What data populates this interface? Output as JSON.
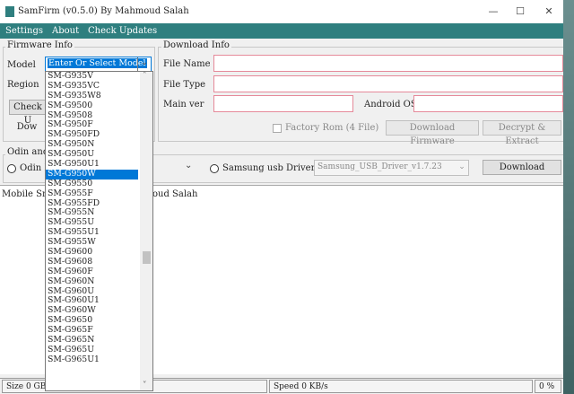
{
  "window": {
    "title": "SamFirm (v0.5.0) By Mahmoud Salah",
    "controls": {
      "minimize": "—",
      "maximize": "☐",
      "close": "✕"
    }
  },
  "menu": [
    "Settings",
    "About",
    "Check Updates"
  ],
  "firmware_info": {
    "title": "Firmware Info",
    "model_label": "Model",
    "model_value": "Enter Or Select Model",
    "region_label": "Region",
    "check_button": "Check U",
    "download_button": "Dow"
  },
  "download_info": {
    "title": "Download Info",
    "file_name_label": "File Name",
    "file_type_label": "File Type",
    "main_ver_label": "Main ver",
    "android_os_label": "Android OS",
    "factory_rom_label": "Factory Rom (4 File)",
    "download_firmware_button": "Download Firmware",
    "decrypt_button": "Decrypt & Extract"
  },
  "odin": {
    "title": "Odin and",
    "odin_radio_label": "Odin F",
    "samsung_usb_label": "Samsung usb Drivers",
    "driver_value": "Samsung_USB_Driver_v1.7.23",
    "download_button": "Download"
  },
  "log": {
    "text_left": "Mobile Sm",
    "text_right": "oud Salah"
  },
  "status": {
    "size": "Size   0 GB",
    "speed": "Speed   0 KB/s",
    "percent": "0 %"
  },
  "model_list": {
    "selected_index": 10,
    "items": [
      "SM-G935V",
      "SM-G935VC",
      "SM-G935W8",
      "SM-G9500",
      "SM-G9508",
      "SM-G950F",
      "SM-G950FD",
      "SM-G950N",
      "SM-G950U",
      "SM-G950U1",
      "SM-G950W",
      "SM-G9550",
      "SM-G955F",
      "SM-G955FD",
      "SM-G955N",
      "SM-G955U",
      "SM-G955U1",
      "SM-G955W",
      "SM-G9600",
      "SM-G9608",
      "SM-G960F",
      "SM-G960N",
      "SM-G960U",
      "SM-G960U1",
      "SM-G960W",
      "SM-G9650",
      "SM-G965F",
      "SM-G965N",
      "SM-G965U",
      "SM-G965U1"
    ]
  },
  "icons": {
    "dropdown_arrow": "⌄",
    "scroll_up": "˄",
    "scroll_down": "˅"
  },
  "colors": {
    "menubar": "#2f7f7f",
    "selection": "#0078d7",
    "required_border": "#e58a9a"
  }
}
